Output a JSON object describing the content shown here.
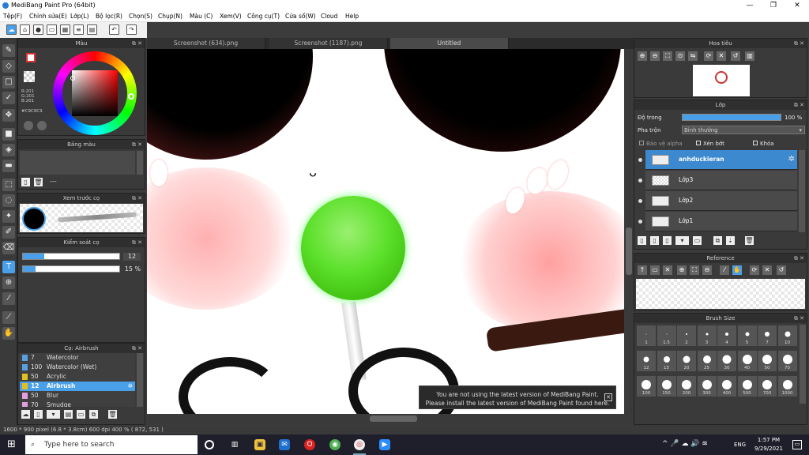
{
  "window": {
    "title": "MediBang Paint Pro (64bit)",
    "minimize": "—",
    "maximize": "❐",
    "close": "✕"
  },
  "menu": [
    "Tệp(F)",
    "Chỉnh sửa(E)",
    "Lớp(L)",
    "Bộ lọc(R)",
    "Chọn(S)",
    "Chụp(N)",
    "Màu (C)",
    "Xem(V)",
    "Công cụ(T)",
    "Cửa sổ(W)",
    "Cloud",
    "Help"
  ],
  "tabs": [
    "Screenshot (634).png",
    "Screenshot (1187).png",
    "Untitled"
  ],
  "color_panel": {
    "title": "Màu",
    "r": "R:201",
    "g": "G:201",
    "b": "B:201",
    "hex": "#C9C9C9"
  },
  "palette_panel": {
    "title": "Bảng màu",
    "placeholder": "---"
  },
  "brush_preview": {
    "title": "Xem trước cọ"
  },
  "brush_control": {
    "title": "Kiểm soát cọ",
    "size": "12",
    "opacity": "15 %",
    "size_fill": 0.22,
    "opacity_fill": 0.13
  },
  "brush_list": {
    "title": "Cọ: Airbrush",
    "items": [
      {
        "num": "7",
        "name": "Watercolor",
        "color": "#5aa0e0"
      },
      {
        "num": "100",
        "name": "Watercolor (Wet)",
        "color": "#5aa0e0"
      },
      {
        "num": "50",
        "name": "Acrylic",
        "color": "#e0c020"
      },
      {
        "num": "12",
        "name": "Airbrush",
        "color": "#e0c020",
        "selected": true
      },
      {
        "num": "50",
        "name": "Blur",
        "color": "#e0a0e0"
      },
      {
        "num": "70",
        "name": "Smudge",
        "color": "#e0a0e0"
      }
    ]
  },
  "navigator": {
    "title": "Hoa tiêu"
  },
  "layer_panel": {
    "title": "Lớp",
    "opacity_label": "Độ trong",
    "opacity_value": "100 %",
    "opacity_fill": 1.0,
    "blend_label": "Pha trộn",
    "blend_value": "Bình thường",
    "protect_alpha": "Bảo vệ alpha",
    "clipping": "Xén bớt",
    "lock": "Khóa",
    "layers": [
      {
        "name": "anhduckieran",
        "selected": true
      },
      {
        "name": "Lớp3"
      },
      {
        "name": "Lớp2"
      },
      {
        "name": "Lớp1"
      }
    ]
  },
  "reference": {
    "title": "Reference"
  },
  "brush_size": {
    "title": "Brush Size",
    "sizes": [
      "1",
      "1.5",
      "2",
      "3",
      "4",
      "5",
      "7",
      "10",
      "12",
      "15",
      "20",
      "25",
      "30",
      "40",
      "50",
      "70",
      "100",
      "150",
      "200",
      "300",
      "400",
      "500",
      "700",
      "1000"
    ]
  },
  "status": "1600 * 900 pixel  (6.8 * 3.8cm)  600 dpi  400 %  ( 872, 531 )",
  "toast": {
    "line1": "You are not using the latest version of MediBang Paint.",
    "line2": "Please install the latest version of MediBang Paint found here.",
    "close": "✕"
  },
  "taskbar": {
    "search_placeholder": "Type here to search",
    "time": "1:57 PM",
    "date": "9/29/2021",
    "lang": "ENG"
  },
  "colors": {
    "accent": "#4aa0e8",
    "lollipop": "#5ce02a",
    "panel": "#3a3a3a"
  }
}
